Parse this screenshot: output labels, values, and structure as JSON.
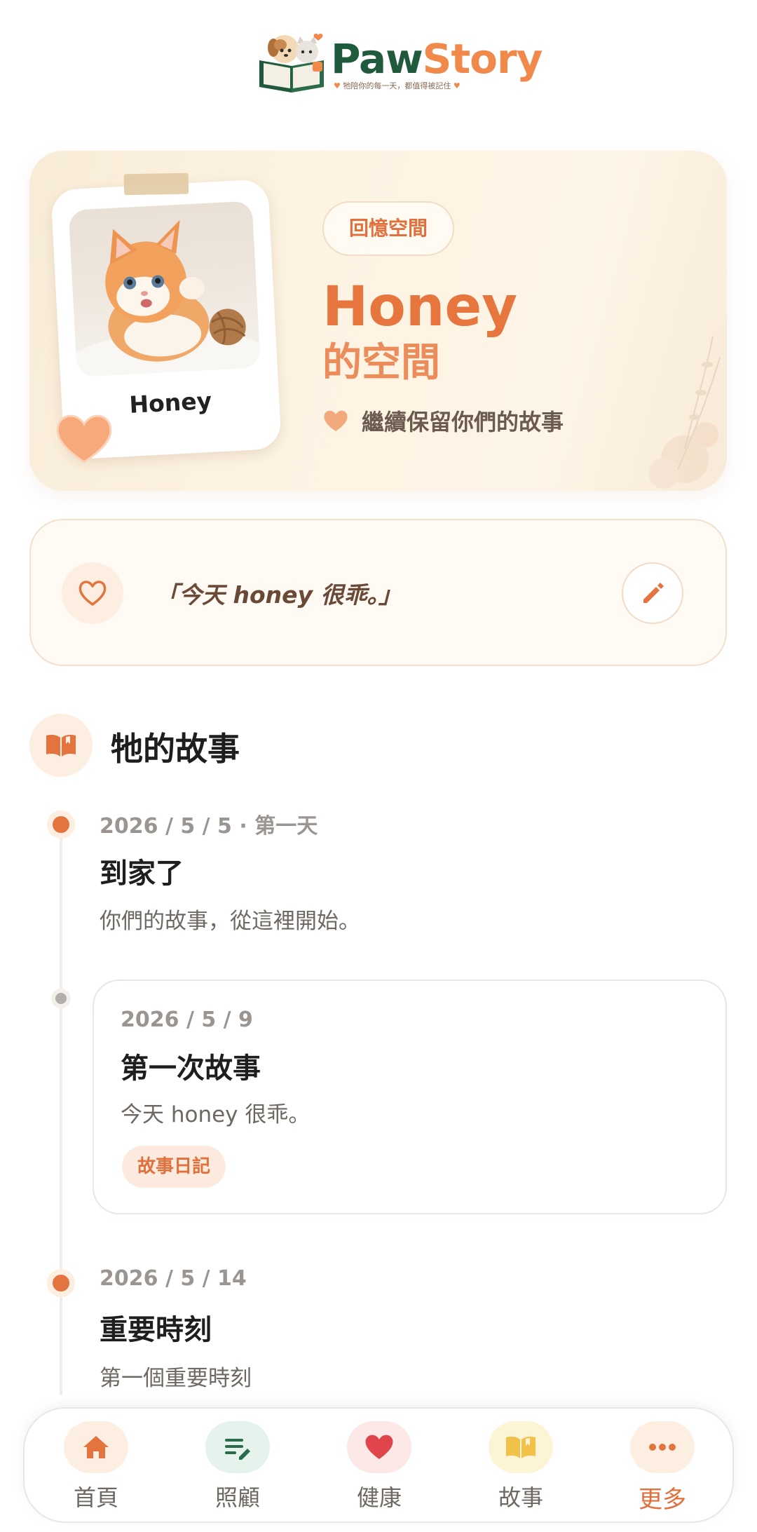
{
  "brand": {
    "name_part1": "Paw",
    "name_part2": "Story",
    "tagline": "牠陪你的每一天，都值得被記住"
  },
  "hero": {
    "pill_label": "回憶空間",
    "pet_name": "Honey",
    "subtitle": "的空間",
    "message": "繼續保留你們的故事",
    "photo_caption": "Honey",
    "accent_color": "#e6753e"
  },
  "quote": {
    "text": "「今天 honey 很乖。」"
  },
  "stories": {
    "title": "牠的故事",
    "events": [
      {
        "date": "2026 / 5 / 5 · 第一天",
        "title": "到家了",
        "desc": "你們的故事，從這裡開始。"
      },
      {
        "date": "2026 / 5 / 9",
        "title": "第一次故事",
        "desc": "今天 honey 很乖。",
        "tag": "故事日記"
      },
      {
        "date": "2026 / 5 / 14",
        "title": "重要時刻",
        "desc": "第一個重要時刻"
      }
    ]
  },
  "nav": {
    "items": [
      {
        "label": "首頁",
        "icon": "home-icon"
      },
      {
        "label": "照顧",
        "icon": "care-list-icon"
      },
      {
        "label": "健康",
        "icon": "heart-icon"
      },
      {
        "label": "故事",
        "icon": "book-icon"
      },
      {
        "label": "更多",
        "icon": "more-icon"
      }
    ],
    "active": "更多"
  }
}
